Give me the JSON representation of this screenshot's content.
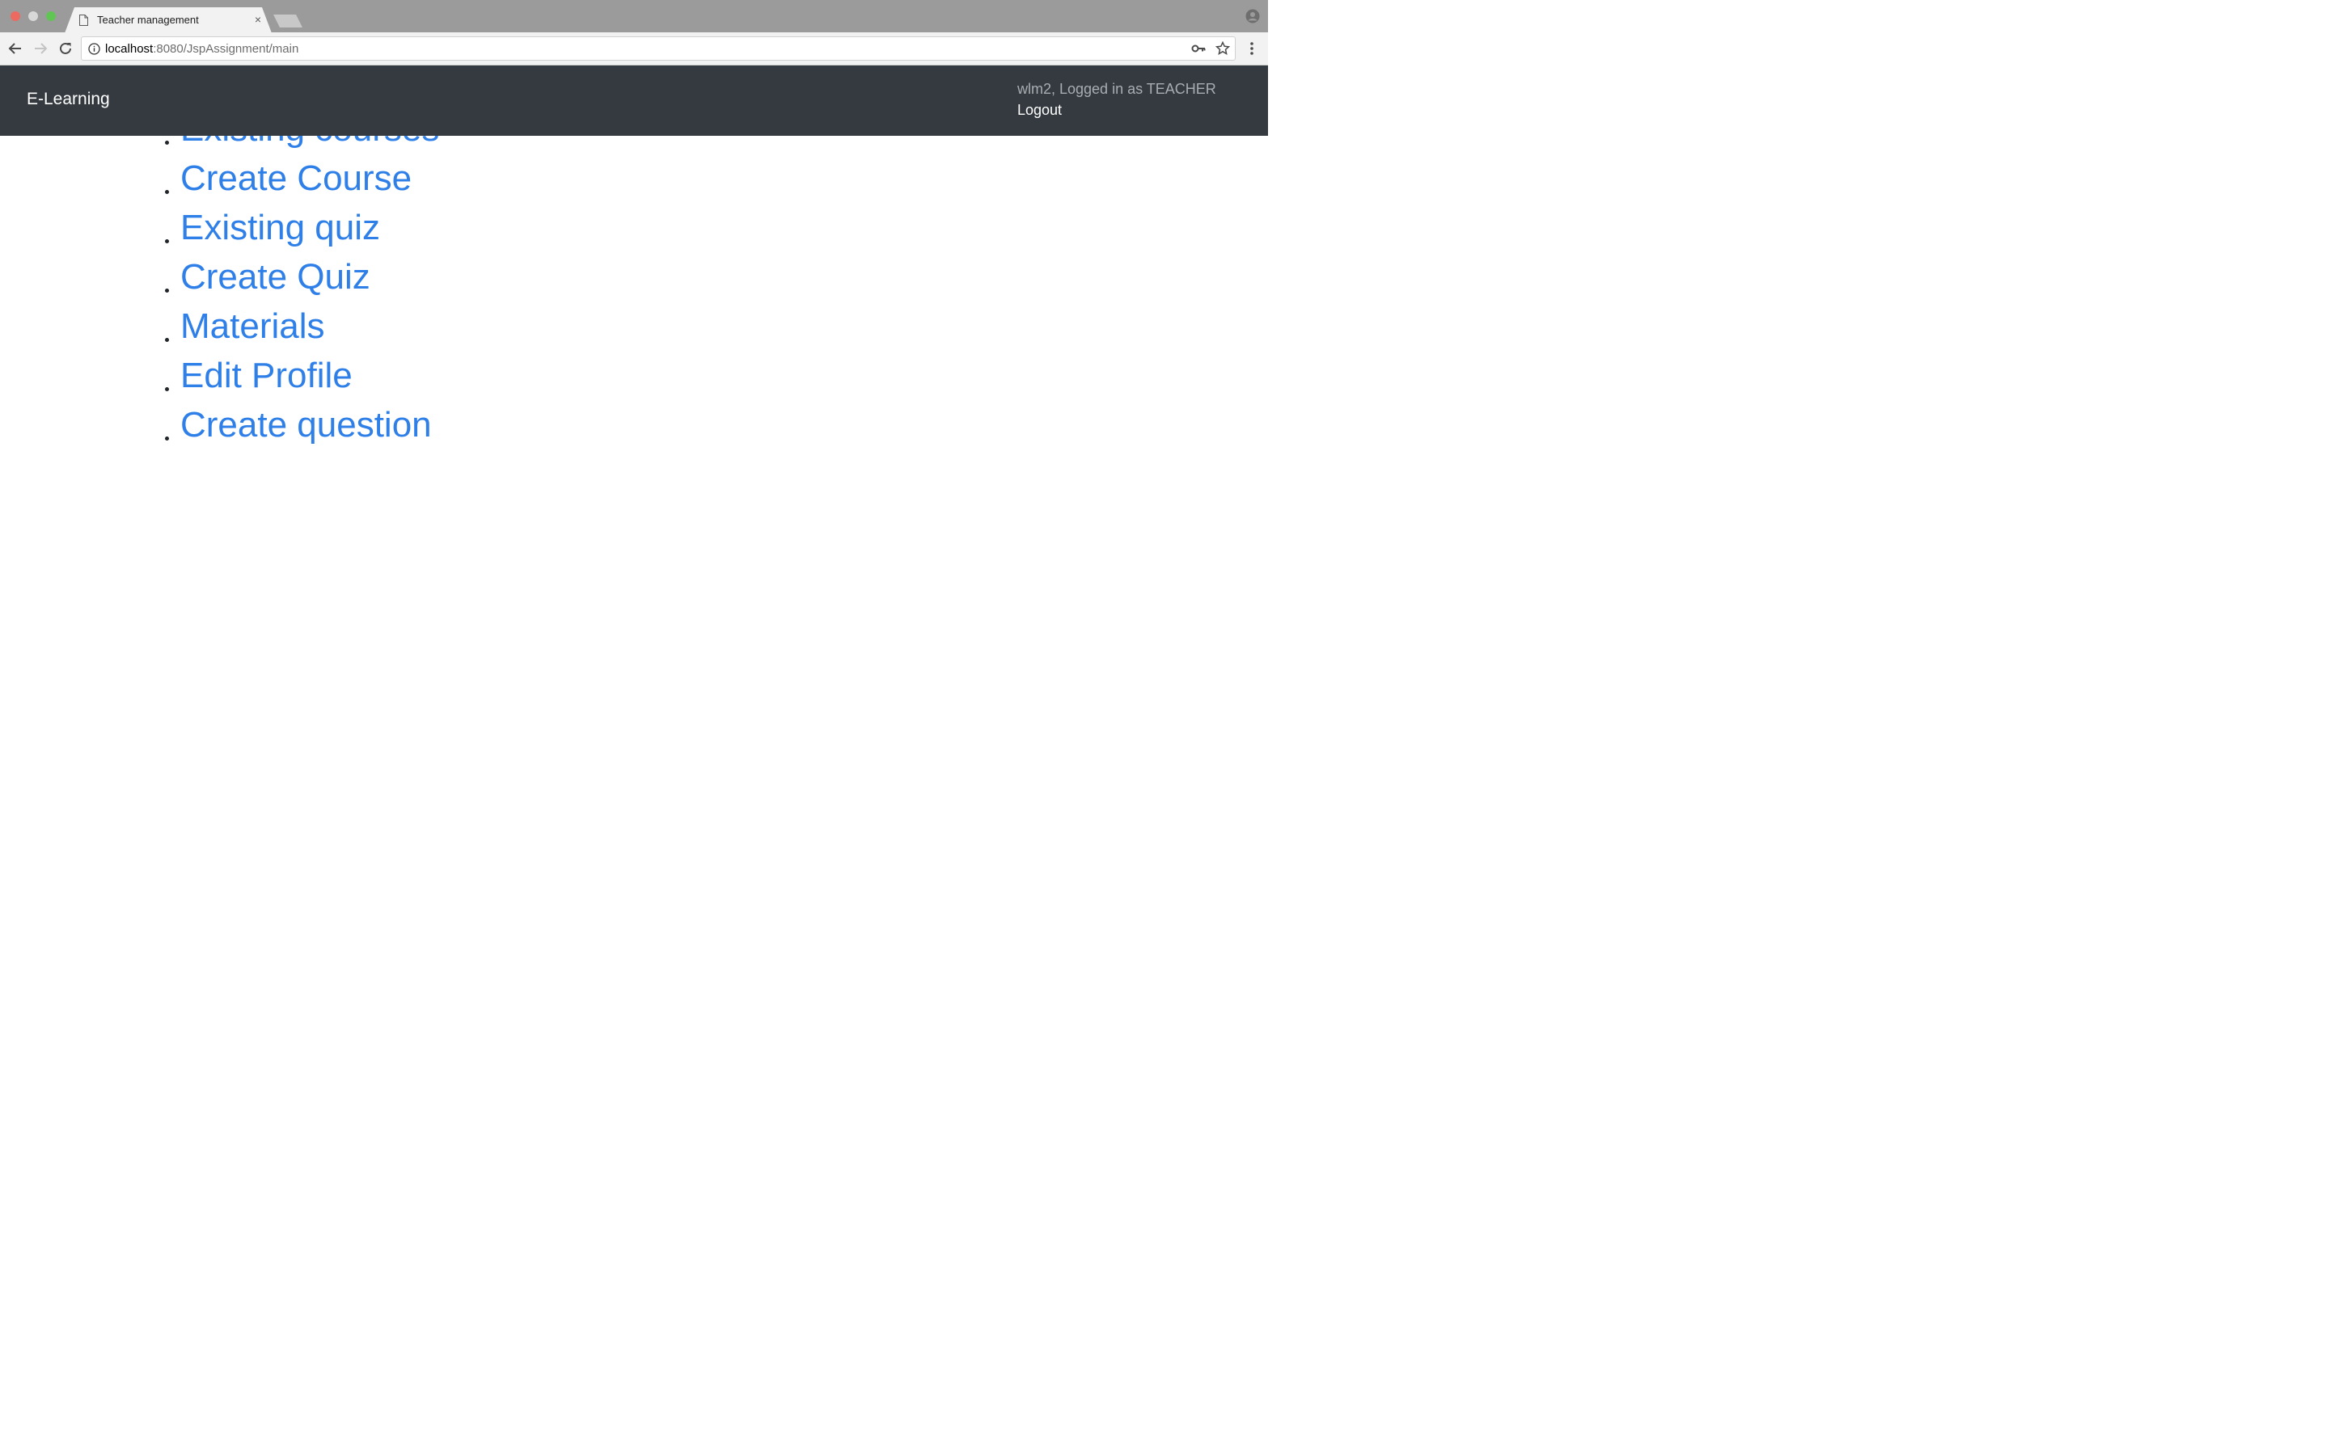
{
  "browser": {
    "tab_title": "Teacher management",
    "tab_close": "×",
    "url_host": "localhost",
    "url_rest": ":8080/JspAssignment/main",
    "icons": {
      "tab": "document-icon",
      "back": "back-arrow-icon",
      "forward": "forward-arrow-icon",
      "reload": "reload-icon",
      "info": "info-icon",
      "key": "key-icon",
      "star": "star-icon",
      "menu": "kebab-menu-icon",
      "profile": "profile-icon"
    }
  },
  "navbar": {
    "brand": "E-Learning",
    "user_status": "wlm2, Logged in as TEACHER",
    "logout": "Logout",
    "background": "#343a40"
  },
  "menu": {
    "link_color": "#2f7fe8",
    "items": [
      {
        "label": "Existing courses"
      },
      {
        "label": "Create Course"
      },
      {
        "label": "Existing quiz"
      },
      {
        "label": "Create Quiz"
      },
      {
        "label": "Materials"
      },
      {
        "label": "Edit Profile"
      },
      {
        "label": "Create question"
      }
    ]
  }
}
